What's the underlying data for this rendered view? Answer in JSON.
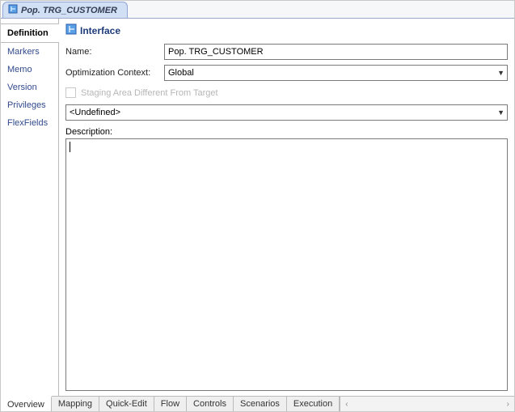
{
  "file_tab": {
    "title": "Pop. TRG_CUSTOMER"
  },
  "sidebar": {
    "items": [
      {
        "label": "Definition",
        "active": true
      },
      {
        "label": "Markers"
      },
      {
        "label": "Memo"
      },
      {
        "label": "Version"
      },
      {
        "label": "Privileges"
      },
      {
        "label": "FlexFields"
      }
    ]
  },
  "content": {
    "title": "Interface",
    "name_label": "Name:",
    "name_value": "Pop. TRG_CUSTOMER",
    "context_label": "Optimization Context:",
    "context_value": "Global",
    "staging_label": "Staging Area Different From Target",
    "staging_checked": false,
    "undefined_value": "<Undefined>",
    "description_label": "Description:",
    "description_value": ""
  },
  "bottom_tabs": {
    "items": [
      {
        "label": "Overview",
        "active": true
      },
      {
        "label": "Mapping"
      },
      {
        "label": "Quick-Edit"
      },
      {
        "label": "Flow"
      },
      {
        "label": "Controls"
      },
      {
        "label": "Scenarios"
      },
      {
        "label": "Execution"
      }
    ]
  }
}
